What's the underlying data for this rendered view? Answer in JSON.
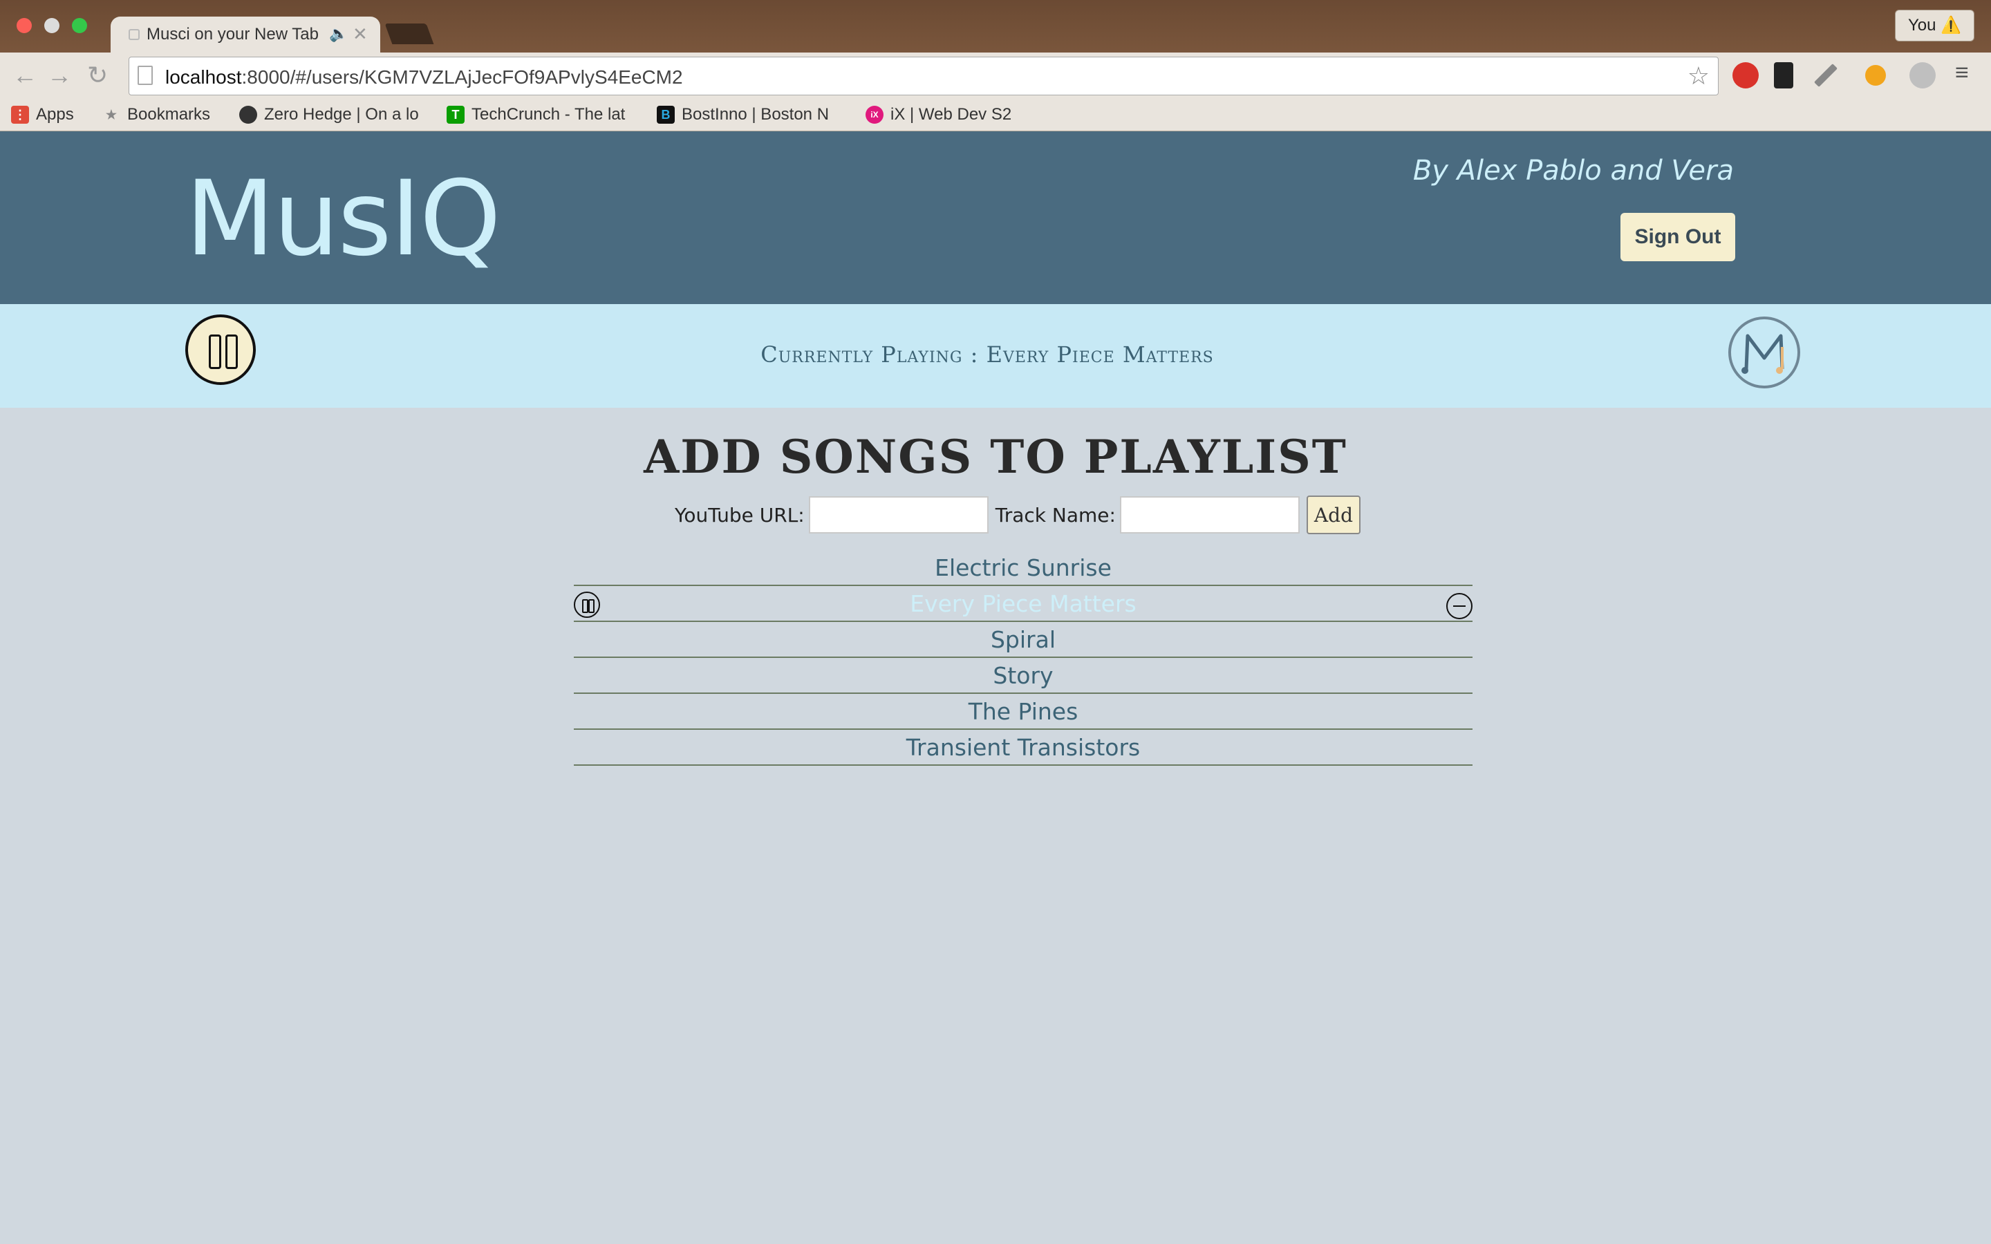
{
  "browser": {
    "tab_title": "Musci on your New Tab",
    "tab_close": "✕",
    "tab_audio": "🔈",
    "profile_label": "You ⚠️",
    "address": {
      "host": "localhost",
      "path": ":8000/#/users/KGM7VZLAjJecFOf9APvlyS4EeCM2"
    },
    "bookmarks": [
      {
        "label": "Apps",
        "icon": "apps-grid-icon",
        "color": "#e04b3a"
      },
      {
        "label": "Bookmarks",
        "icon": "star-icon",
        "color": "#888888"
      },
      {
        "label": "Zero Hedge | On a lo",
        "icon": "zerohedge-icon",
        "color": "#333333"
      },
      {
        "label": "TechCrunch - The lat",
        "icon": "techcrunch-icon",
        "color": "#0a9e01"
      },
      {
        "label": "BostInno | Boston N",
        "icon": "bostinno-icon",
        "color": "#111111"
      },
      {
        "label": "iX | Web Dev S2",
        "icon": "ix-icon",
        "color": "#e0197d"
      }
    ]
  },
  "app": {
    "logo": "MusIQ",
    "byline": "By Alex Pablo and Vera",
    "signout_label": "Sign Out",
    "now_playing": "Currently Playing : Every Piece Matters",
    "heading": "ADD SONGS TO PLAYLIST",
    "form": {
      "url_label": "YouTube URL:",
      "track_label": "Track Name:",
      "add_label": "Add"
    },
    "tracks": [
      {
        "name": "Electric Sunrise",
        "playing": false
      },
      {
        "name": "Every Piece Matters",
        "playing": true
      },
      {
        "name": "Spiral",
        "playing": false
      },
      {
        "name": "Story",
        "playing": false
      },
      {
        "name": "The Pines",
        "playing": false
      },
      {
        "name": "Transient Transistors",
        "playing": false
      }
    ]
  },
  "colors": {
    "header_bg": "#4a6b80",
    "nowbar_bg": "#c7e9f5",
    "page_bg": "#d0d8df",
    "accent_cream": "#f6efcf",
    "logo_text": "#cdeff9"
  }
}
